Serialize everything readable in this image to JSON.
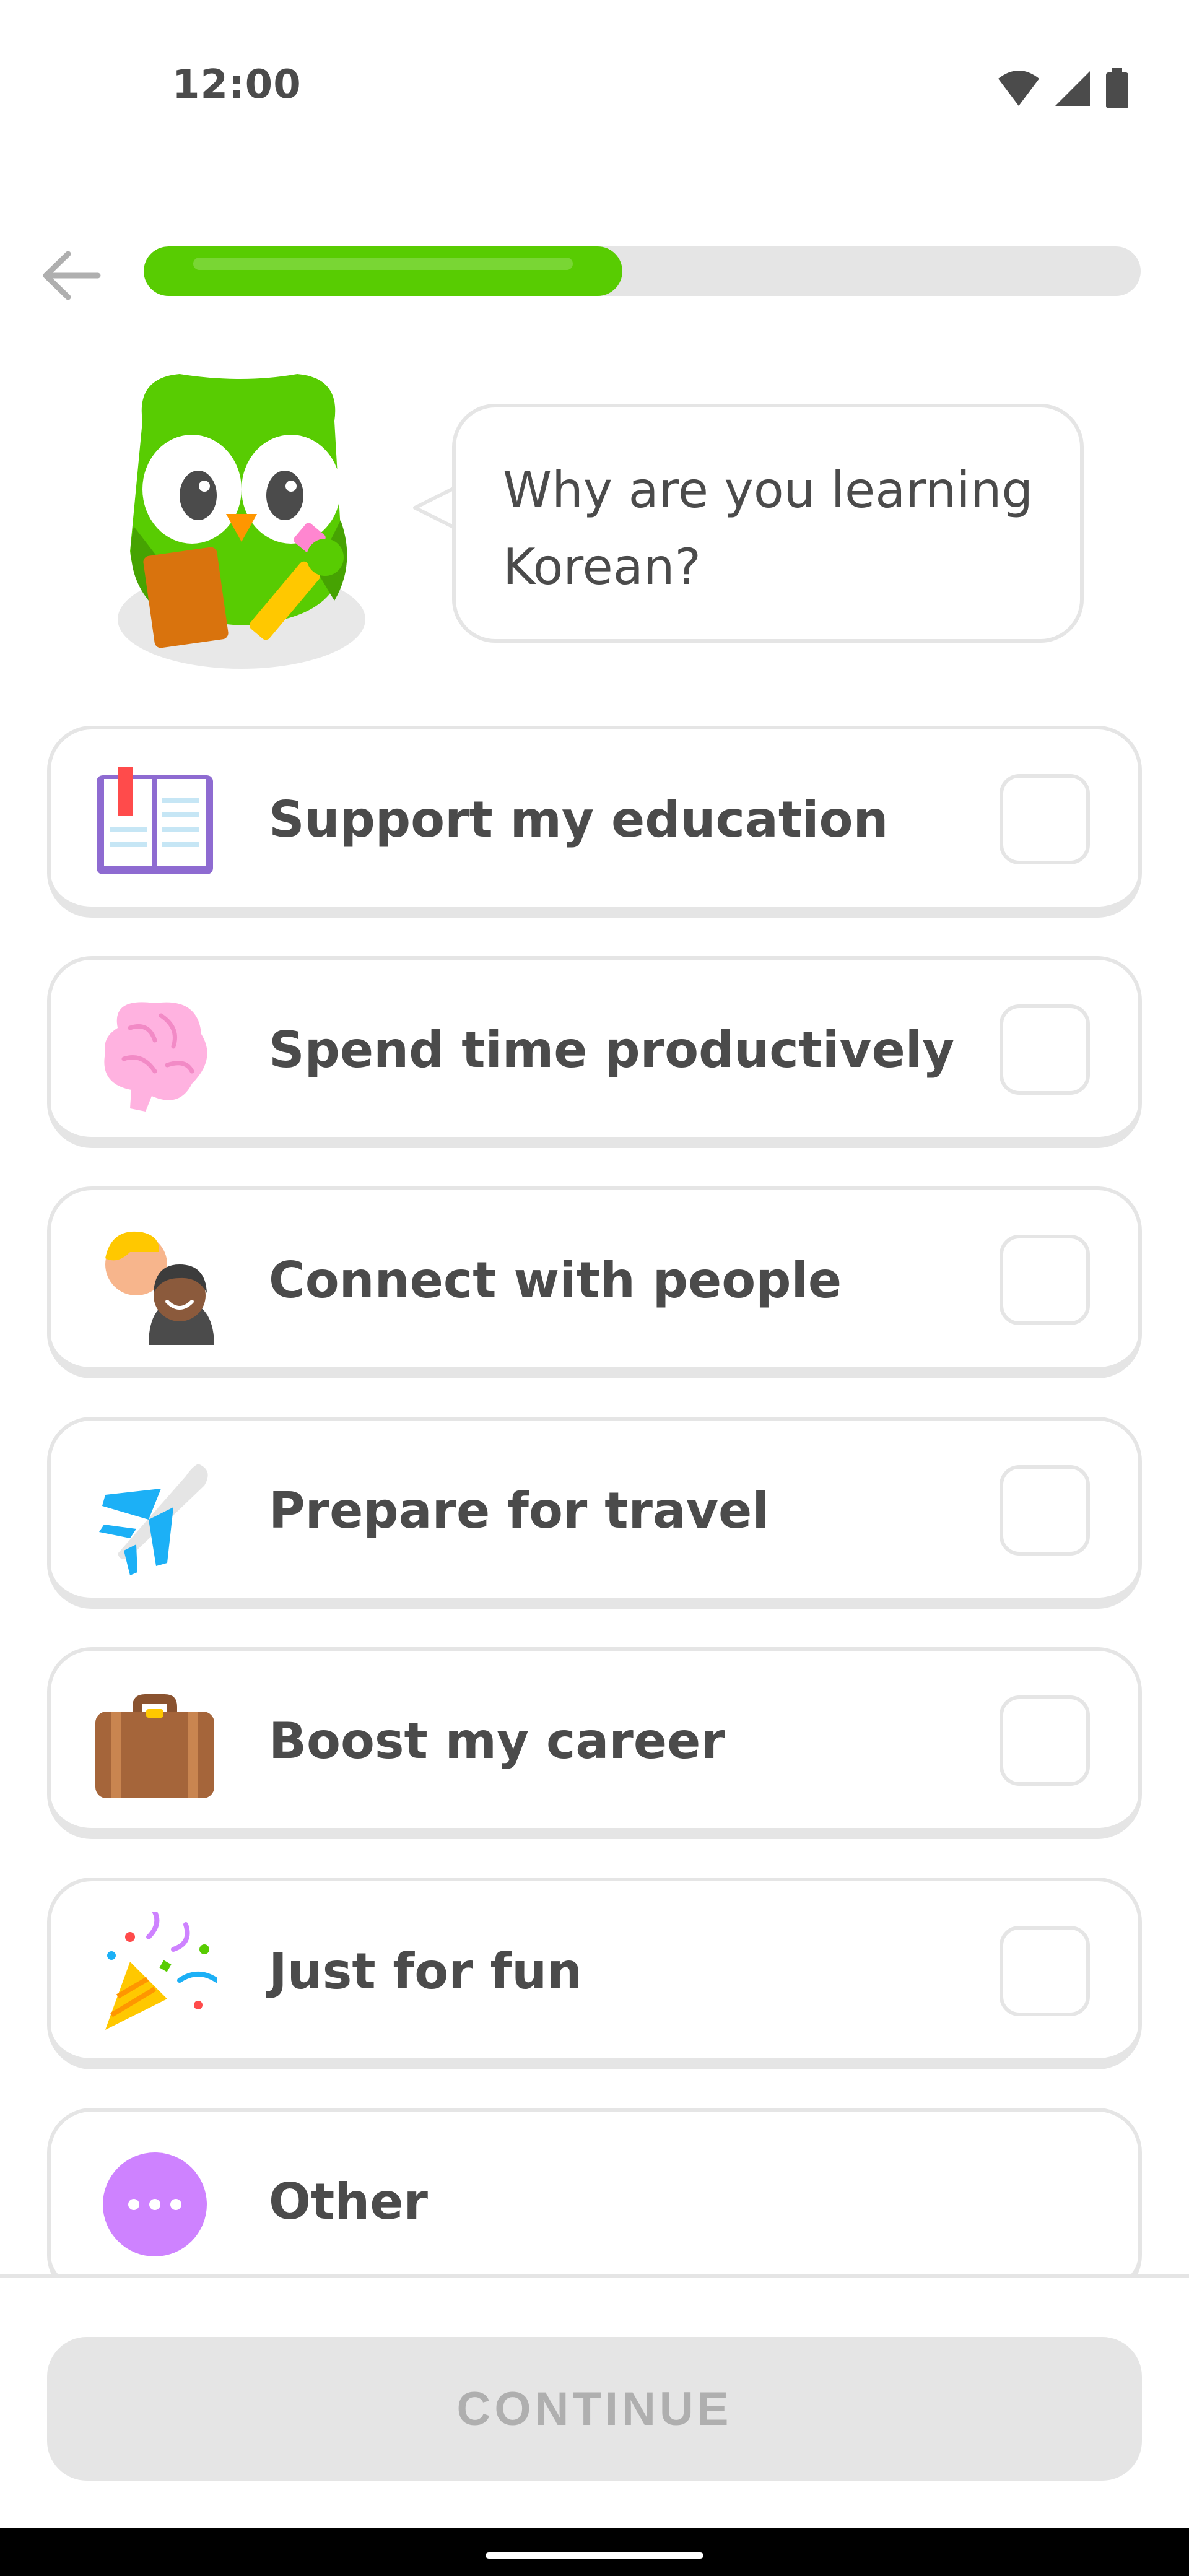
{
  "status_bar": {
    "time": "12:00",
    "icons": [
      "wifi-icon",
      "signal-icon",
      "battery-icon"
    ]
  },
  "top_bar": {
    "back_icon": "arrow-left-icon",
    "progress_percent": 48
  },
  "prompt": {
    "question": "Why are you learning Korean?"
  },
  "options": [
    {
      "label": "Support my education",
      "icon": "book-icon",
      "checked": false
    },
    {
      "label": "Spend time productively",
      "icon": "brain-icon",
      "checked": false
    },
    {
      "label": "Connect with people",
      "icon": "people-icon",
      "checked": false
    },
    {
      "label": "Prepare for travel",
      "icon": "airplane-icon",
      "checked": false
    },
    {
      "label": "Boost my career",
      "icon": "briefcase-icon",
      "checked": false
    },
    {
      "label": "Just for fun",
      "icon": "party-popper-icon",
      "checked": false
    },
    {
      "label": "Other",
      "icon": "more-dots-icon"
    }
  ],
  "footer": {
    "continue_label": "CONTINUE"
  },
  "colors": {
    "accent_green": "#58cc02",
    "border_gray": "#e5e5e5",
    "text_dark": "#4b4b4b",
    "disabled_text": "#afafaf",
    "other_purple": "#ce82ff"
  }
}
